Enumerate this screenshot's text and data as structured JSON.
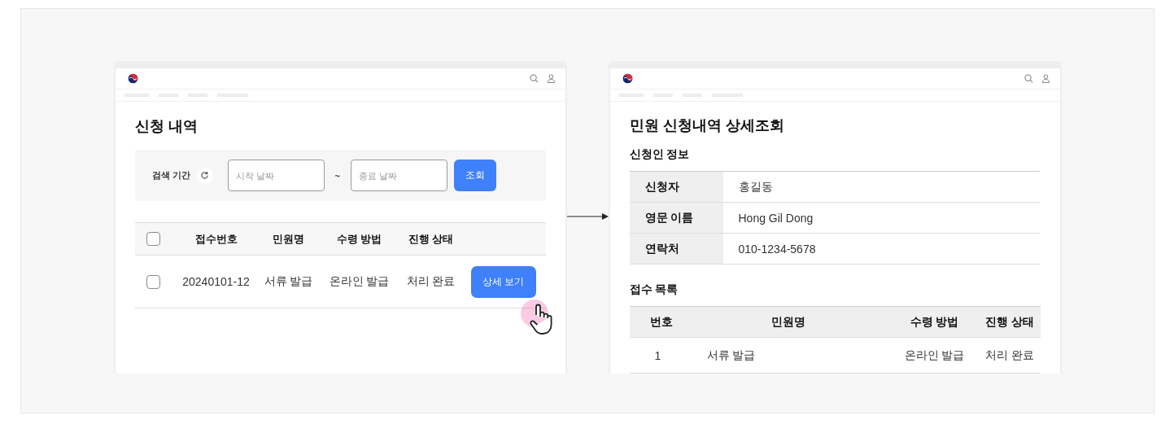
{
  "list_screen": {
    "title": "신청 내역",
    "search": {
      "label": "검색 기간",
      "start_placeholder": "시작 날짜",
      "separator": "~",
      "end_placeholder": "종료 날짜",
      "button": "조회"
    },
    "table": {
      "select_all_checked": false,
      "columns": [
        "접수번호",
        "민원명",
        "수령 방법",
        "진행 상태"
      ],
      "rows": [
        {
          "checked": false,
          "cells": [
            "20240101-12",
            "서류 발급",
            "온라인 발급",
            "처리 완료"
          ],
          "action": "상세 보기"
        }
      ]
    }
  },
  "detail_screen": {
    "title": "민원 신청내역 상세조회",
    "applicant": {
      "heading": "신청인 정보",
      "rows": [
        {
          "label": "신청자",
          "value": "홍길동"
        },
        {
          "label": "영문 이름",
          "value": "Hong Gil Dong"
        },
        {
          "label": "연락처",
          "value": "010-1234-5678"
        }
      ]
    },
    "receipts": {
      "heading": "접수 목록",
      "columns": [
        "번호",
        "민원명",
        "수령 방법",
        "진행 상태"
      ],
      "rows": [
        {
          "cells": [
            "1",
            "서류 발급",
            "온라인 발급",
            "처리 완료"
          ]
        }
      ]
    }
  }
}
